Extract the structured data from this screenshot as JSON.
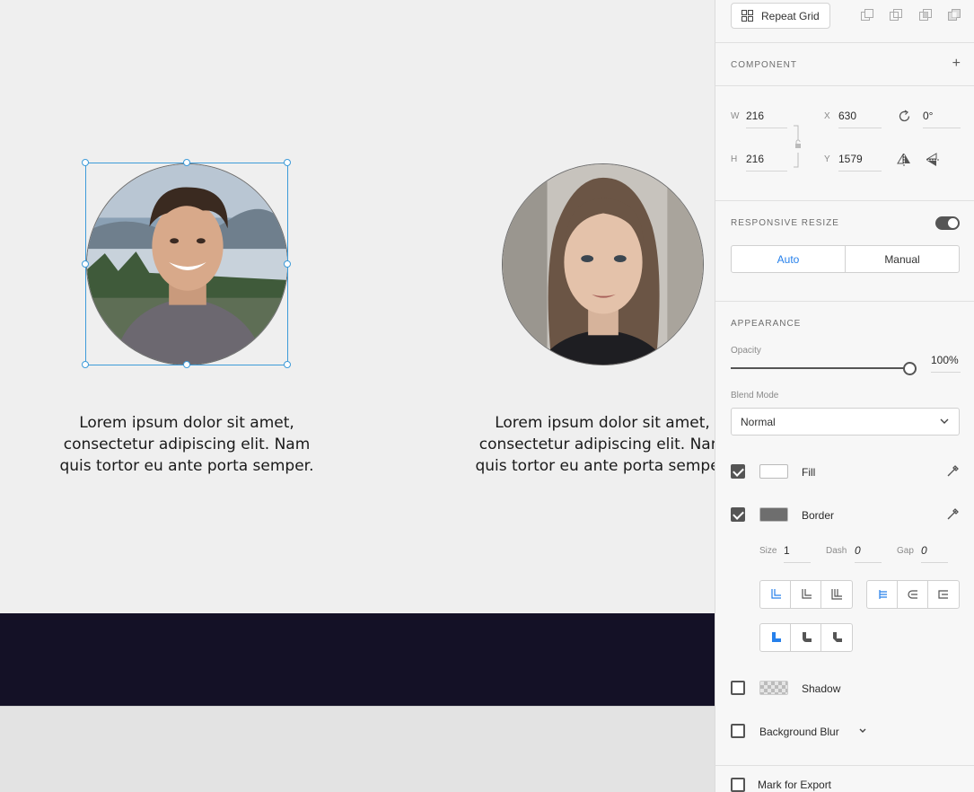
{
  "canvas": {
    "captions": [
      "Lorem ipsum dolor sit amet, consectetur adipiscing elit. Nam quis tortor eu ante porta semper.",
      "Lorem ipsum dolor sit amet, consectetur adipiscing elit. Nam quis tortor eu ante porta semper."
    ],
    "caption_lines": [
      [
        "Lorem ipsum dolor sit amet,",
        "consectetur adipiscing elit. Nam",
        "quis tortor eu ante porta semper."
      ],
      [
        "Lorem ipsum dolor sit amet,",
        "consectetur adipiscing elit. Nam",
        "quis tortor eu ante porta semper."
      ]
    ],
    "band_color": "#141126",
    "selection_color": "#3d9bd9"
  },
  "panel": {
    "repeat_grid_label": "Repeat Grid",
    "component_title": "COMPONENT",
    "transform": {
      "w_label": "W",
      "w_value": "216",
      "h_label": "H",
      "h_value": "216",
      "x_label": "X",
      "x_value": "630",
      "y_label": "Y",
      "y_value": "1579",
      "rotation_value": "0°"
    },
    "responsive": {
      "title": "RESPONSIVE RESIZE",
      "enabled": true,
      "auto_label": "Auto",
      "manual_label": "Manual"
    },
    "appearance": {
      "title": "APPEARANCE",
      "opacity_label": "Opacity",
      "opacity_value": "100%",
      "blend_label": "Blend Mode",
      "blend_value": "Normal"
    },
    "fill": {
      "label": "Fill",
      "checked": true,
      "color": "#ffffff"
    },
    "border": {
      "label": "Border",
      "checked": true,
      "color": "#6e6e6e",
      "size_label": "Size",
      "size_value": "1",
      "dash_label": "Dash",
      "dash_value": "0",
      "gap_label": "Gap",
      "gap_value": "0"
    },
    "shadow": {
      "label": "Shadow",
      "checked": false
    },
    "background_blur": {
      "label": "Background Blur",
      "checked": false
    },
    "export": {
      "label": "Mark for Export",
      "checked": false
    },
    "accent_color": "#2680eb"
  }
}
